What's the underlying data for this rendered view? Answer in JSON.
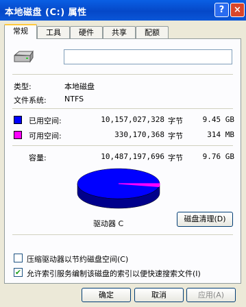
{
  "window": {
    "title": "本地磁盘 (C:) 属性",
    "help_glyph": "?",
    "close_glyph": "×"
  },
  "tabs": [
    "常规",
    "工具",
    "硬件",
    "共享",
    "配额"
  ],
  "general": {
    "name_value": "",
    "type_label": "类型:",
    "type_value": "本地磁盘",
    "fs_label": "文件系统:",
    "fs_value": "NTFS",
    "used": {
      "label": "已用空间:",
      "bytes": "10,157,027,328",
      "unit": "字节",
      "size": "9.45 GB",
      "color": "#0000FF"
    },
    "free": {
      "label": "可用空间:",
      "bytes": "330,170,368",
      "unit": "字节",
      "size": "314 MB",
      "color": "#FF00FF"
    },
    "capacity": {
      "label": "容量:",
      "bytes": "10,487,197,696",
      "unit": "字节",
      "size": "9.76 GB"
    },
    "drive_label": "驱动器 C",
    "cleanup_button": "磁盘清理(D)",
    "compress_label": "压缩驱动器以节约磁盘空间(C)",
    "compress_checked": false,
    "index_label": "允许索引服务编制该磁盘的索引以便快速搜索文件(I)",
    "index_checked": true,
    "check_glyph": "✔"
  },
  "buttons": {
    "ok": "确定",
    "cancel": "取消",
    "apply": "应用(A)"
  },
  "chart_data": {
    "type": "pie",
    "categories": [
      "已用空间",
      "可用空间"
    ],
    "values": [
      10157027328,
      330170368
    ],
    "colors": [
      "#0000FF",
      "#FF00FF"
    ]
  }
}
